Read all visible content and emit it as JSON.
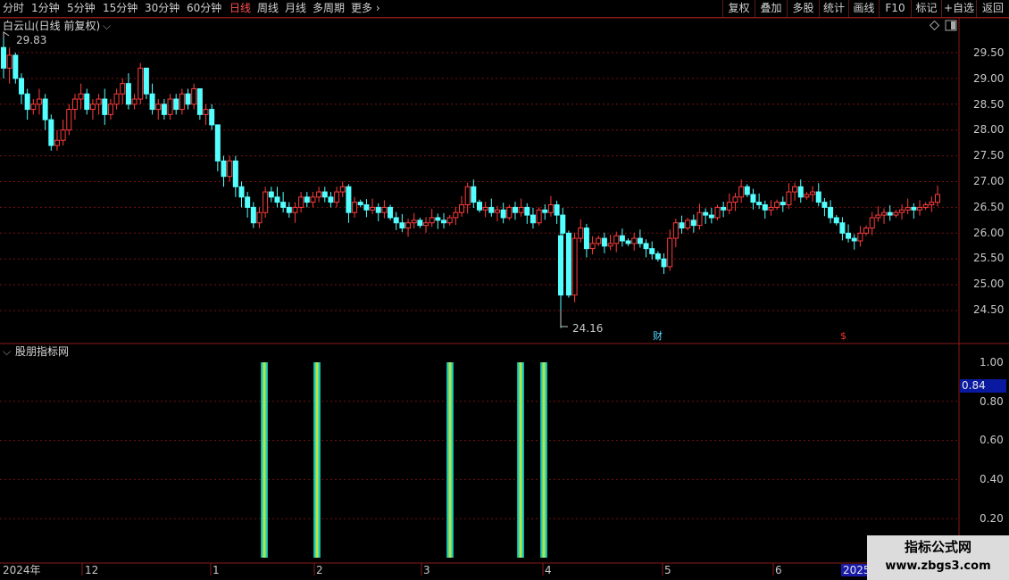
{
  "toolbar": {
    "periods": [
      {
        "label": "分时",
        "active": false
      },
      {
        "label": "1分钟",
        "active": false
      },
      {
        "label": "5分钟",
        "active": false
      },
      {
        "label": "15分钟",
        "active": false
      },
      {
        "label": "30分钟",
        "active": false
      },
      {
        "label": "60分钟",
        "active": false
      },
      {
        "label": "日线",
        "active": true
      },
      {
        "label": "周线",
        "active": false
      },
      {
        "label": "月线",
        "active": false
      },
      {
        "label": "多周期",
        "active": false
      }
    ],
    "more_label": "更多",
    "right_buttons": [
      "复权",
      "叠加",
      "多股",
      "统计",
      "画线",
      "F10",
      "标记",
      "+自选",
      "返回"
    ]
  },
  "main_panel": {
    "title": "白云山(日线 前复权)",
    "high_label": "29.83",
    "low_label": "24.16",
    "y_ticks": [
      "29.50",
      "29.00",
      "28.50",
      "28.00",
      "27.50",
      "27.00",
      "26.50",
      "26.00",
      "25.50",
      "25.00",
      "24.50"
    ],
    "marker_cai": "财",
    "marker_dollar": "$"
  },
  "indicator_panel": {
    "title": "股朋指标网",
    "y_ticks": [
      "1.00",
      "0.80",
      "0.60",
      "0.40",
      "0.20"
    ],
    "current_value": "0.84"
  },
  "x_axis": {
    "year_label": "2024年",
    "month_labels": [
      "12",
      "1",
      "2",
      "3",
      "4",
      "5",
      "6"
    ],
    "year_box": "2025"
  },
  "watermark": {
    "line1": "指标公式网",
    "line2": "www.zbgs3.com"
  },
  "colors": {
    "up": "#ff3c3c",
    "down": "#54ffff",
    "grid": "#7a1010",
    "axis_text": "#c8c8c8",
    "active": "#ff5050"
  },
  "chart_data": {
    "type": "candlestick",
    "price_range": [
      24.16,
      29.83
    ],
    "candles_ohlc_approx": [
      [
        29.6,
        29.83,
        29.0,
        29.2
      ],
      [
        29.2,
        29.6,
        28.9,
        29.45
      ],
      [
        29.45,
        29.5,
        28.9,
        29.0
      ],
      [
        29.0,
        29.1,
        28.5,
        28.7
      ],
      [
        28.7,
        28.8,
        28.2,
        28.4
      ],
      [
        28.4,
        28.6,
        28.3,
        28.5
      ],
      [
        28.5,
        28.8,
        28.3,
        28.6
      ],
      [
        28.6,
        28.7,
        28.0,
        28.2
      ],
      [
        28.2,
        28.3,
        27.6,
        27.7
      ],
      [
        27.7,
        28.0,
        27.6,
        27.8
      ],
      [
        27.8,
        28.2,
        27.7,
        28.0
      ],
      [
        28.0,
        28.5,
        27.9,
        28.4
      ],
      [
        28.4,
        28.7,
        28.2,
        28.6
      ],
      [
        28.6,
        28.9,
        28.4,
        28.7
      ],
      [
        28.7,
        28.8,
        28.3,
        28.4
      ],
      [
        28.4,
        28.6,
        28.2,
        28.5
      ],
      [
        28.5,
        28.7,
        28.3,
        28.6
      ],
      [
        28.6,
        28.8,
        28.1,
        28.3
      ],
      [
        28.3,
        28.6,
        28.2,
        28.5
      ],
      [
        28.5,
        28.8,
        28.4,
        28.7
      ],
      [
        28.7,
        29.0,
        28.5,
        28.9
      ],
      [
        28.9,
        29.1,
        28.4,
        28.5
      ],
      [
        28.5,
        28.7,
        28.4,
        28.6
      ],
      [
        28.6,
        29.3,
        28.5,
        29.2
      ],
      [
        29.2,
        29.2,
        28.6,
        28.7
      ],
      [
        28.7,
        28.9,
        28.3,
        28.4
      ],
      [
        28.4,
        28.6,
        28.2,
        28.5
      ],
      [
        28.5,
        28.6,
        28.2,
        28.3
      ],
      [
        28.3,
        28.7,
        28.2,
        28.6
      ],
      [
        28.6,
        28.7,
        28.3,
        28.4
      ],
      [
        28.4,
        28.8,
        28.3,
        28.7
      ],
      [
        28.7,
        28.8,
        28.4,
        28.5
      ],
      [
        28.5,
        28.9,
        28.4,
        28.8
      ],
      [
        28.8,
        28.8,
        28.2,
        28.3
      ],
      [
        28.3,
        28.5,
        28.1,
        28.4
      ],
      [
        28.4,
        28.5,
        28.0,
        28.1
      ],
      [
        28.1,
        28.1,
        27.2,
        27.4
      ],
      [
        27.4,
        27.5,
        26.9,
        27.1
      ],
      [
        27.1,
        27.5,
        27.0,
        27.4
      ],
      [
        27.4,
        27.5,
        26.7,
        26.9
      ],
      [
        26.9,
        27.0,
        26.5,
        26.7
      ],
      [
        26.7,
        26.8,
        26.3,
        26.5
      ],
      [
        26.5,
        26.6,
        26.1,
        26.2
      ],
      [
        26.2,
        26.5,
        26.1,
        26.4
      ],
      [
        26.4,
        26.9,
        26.3,
        26.8
      ],
      [
        26.8,
        26.9,
        26.6,
        26.7
      ],
      [
        26.7,
        26.9,
        26.5,
        26.6
      ],
      [
        26.6,
        26.8,
        26.4,
        26.5
      ],
      [
        26.5,
        26.6,
        26.3,
        26.4
      ],
      [
        26.4,
        26.6,
        26.2,
        26.5
      ],
      [
        26.5,
        26.8,
        26.4,
        26.7
      ],
      [
        26.7,
        26.8,
        26.5,
        26.6
      ],
      [
        26.6,
        26.8,
        26.5,
        26.7
      ],
      [
        26.7,
        26.9,
        26.6,
        26.8
      ],
      [
        26.8,
        26.9,
        26.6,
        26.7
      ],
      [
        26.7,
        26.8,
        26.5,
        26.6
      ],
      [
        26.6,
        26.9,
        26.5,
        26.8
      ],
      [
        26.8,
        27.0,
        26.7,
        26.9
      ],
      [
        26.9,
        26.95,
        26.2,
        26.4
      ],
      [
        26.4,
        26.7,
        26.3,
        26.6
      ]
    ],
    "indicator_signal_bars": {
      "value": 1.0,
      "count": 5
    }
  }
}
